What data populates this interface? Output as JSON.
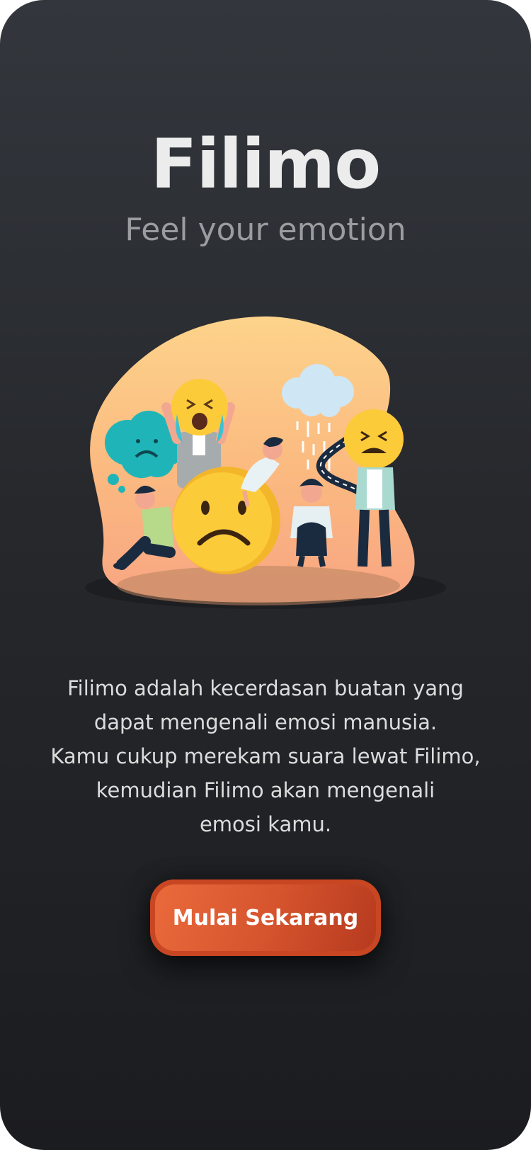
{
  "app": {
    "title": "Filimo",
    "tagline": "Feel your emotion"
  },
  "illustration": {
    "icon": "sad-people-emotions-illustration",
    "colors": {
      "blob_top": "#fdd28a",
      "blob_bottom": "#f7a07a",
      "emoji": "#fccb3a",
      "cloud_teal": "#1fb5b8",
      "rain_cloud": "#cfe6f5"
    }
  },
  "description": {
    "lines": [
      "Filimo adalah kecerdasan buatan yang",
      "dapat mengenali emosi manusia.",
      "Kamu cukup merekam suara lewat Filimo,",
      "kemudian Filimo akan mengenali",
      "emosi kamu."
    ]
  },
  "cta": {
    "label": "Mulai Sekarang",
    "color": "#d7552e"
  }
}
